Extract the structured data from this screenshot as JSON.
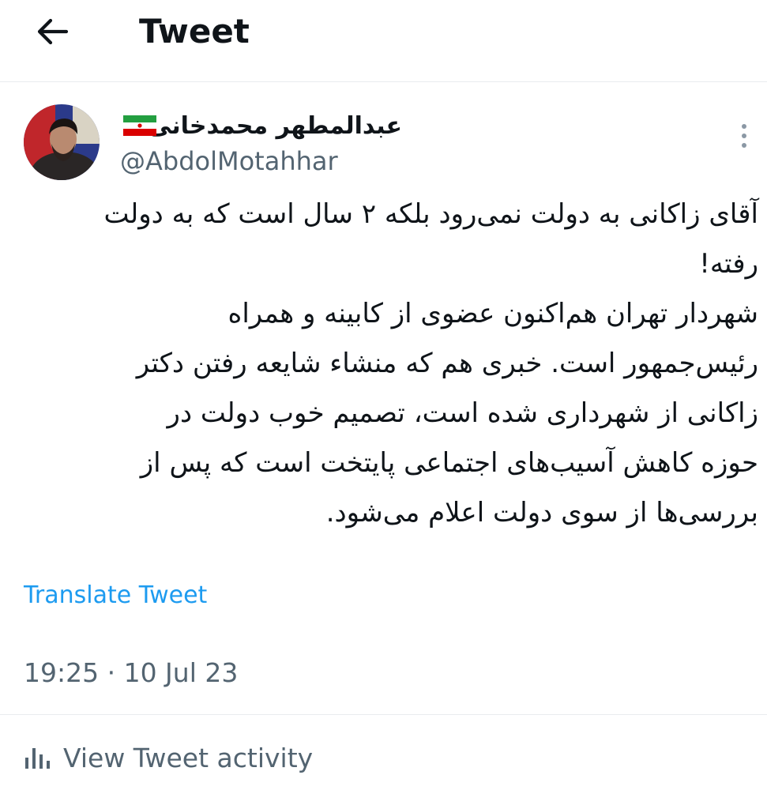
{
  "header": {
    "title": "Tweet",
    "back_icon": "back-arrow-icon"
  },
  "author": {
    "display_name": "عبدالمطهر محمدخانی",
    "handle": "@AbdolMotahhar",
    "flag": "iran-flag-emoji",
    "more_icon": "more-vertical-icon"
  },
  "tweet": {
    "lines": [
      "آقای زاکانی به دولت نمی‌رود بلکه ۲ سال است که به دولت",
      "رفته!",
      "شهردار تهران هم‌اکنون عضوی از کابینه و همراه",
      "رئیس‌جمهور است. خبری هم که منشاء شایعه رفتن دکتر",
      "زاکانی از شهرداری شده است، تصمیم خوب دولت در",
      "حوزه کاهش آسیب‌های اجتماعی پایتخت است که پس از",
      "بررسی‌ها از سوی دولت اعلام می‌شود."
    ]
  },
  "translate_label": "Translate Tweet",
  "timestamp": "19:25 · 10 Jul 23",
  "activity": {
    "label": "View Tweet activity",
    "icon": "analytics-bars-icon"
  },
  "colors": {
    "link": "#1d9bf0",
    "secondary_text": "#536471",
    "primary_text": "#0f1419",
    "divider": "#e9ecee"
  }
}
